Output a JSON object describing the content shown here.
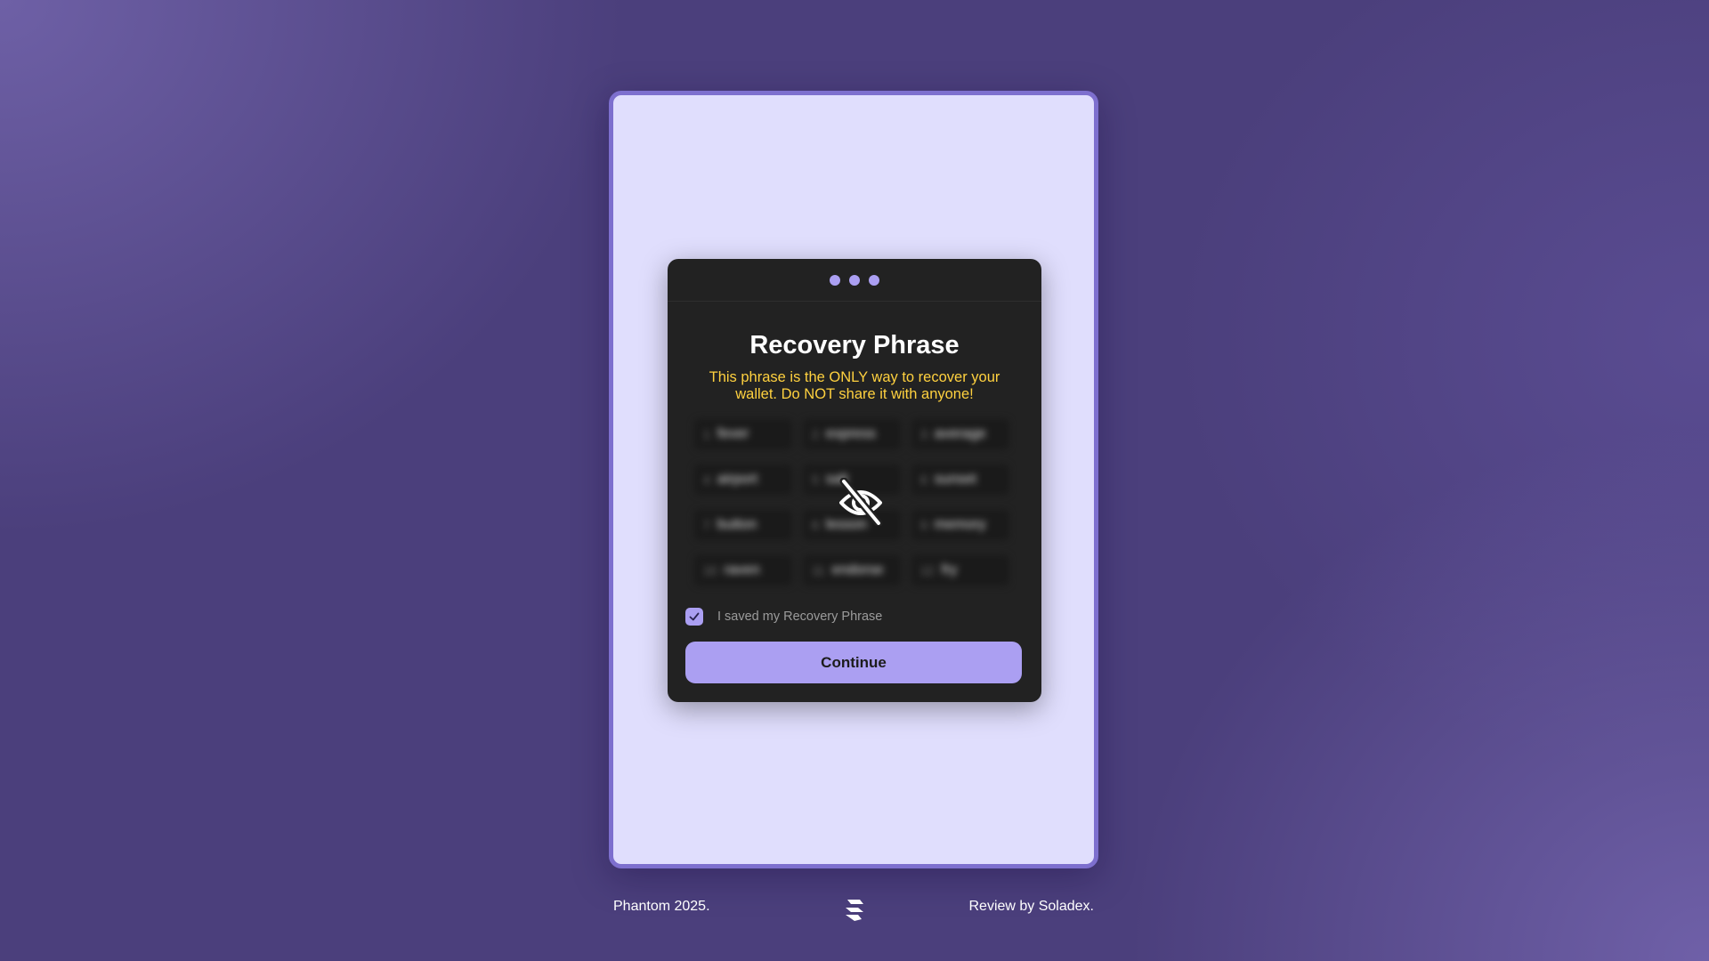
{
  "dialog": {
    "step_dots": 3,
    "title": "Recovery Phrase",
    "warning": "This phrase is the ONLY way to recover your wallet. Do NOT share it with anyone!",
    "words": [
      {
        "n": "1",
        "w": "fever"
      },
      {
        "n": "2",
        "w": "express"
      },
      {
        "n": "3",
        "w": "average"
      },
      {
        "n": "4",
        "w": "airport"
      },
      {
        "n": "5",
        "w": "salt"
      },
      {
        "n": "6",
        "w": "sunset"
      },
      {
        "n": "7",
        "w": "button"
      },
      {
        "n": "8",
        "w": "lesson"
      },
      {
        "n": "9",
        "w": "memory"
      },
      {
        "n": "10",
        "w": "raven"
      },
      {
        "n": "11",
        "w": "endorse"
      },
      {
        "n": "12",
        "w": "fry"
      }
    ],
    "reveal_icon": "eye-off-icon",
    "checkbox_checked": true,
    "checkbox_label": "I saved my Recovery Phrase",
    "continue_label": "Continue"
  },
  "footer": {
    "left": "Phantom 2025.",
    "right": "Review by Soladex.",
    "logo_icon": "soladex-logo-icon"
  },
  "colors": {
    "accent": "#ab9ff2",
    "warning": "#ffd13f",
    "dialog_bg": "#222222",
    "frame_bg": "#e0defd"
  }
}
